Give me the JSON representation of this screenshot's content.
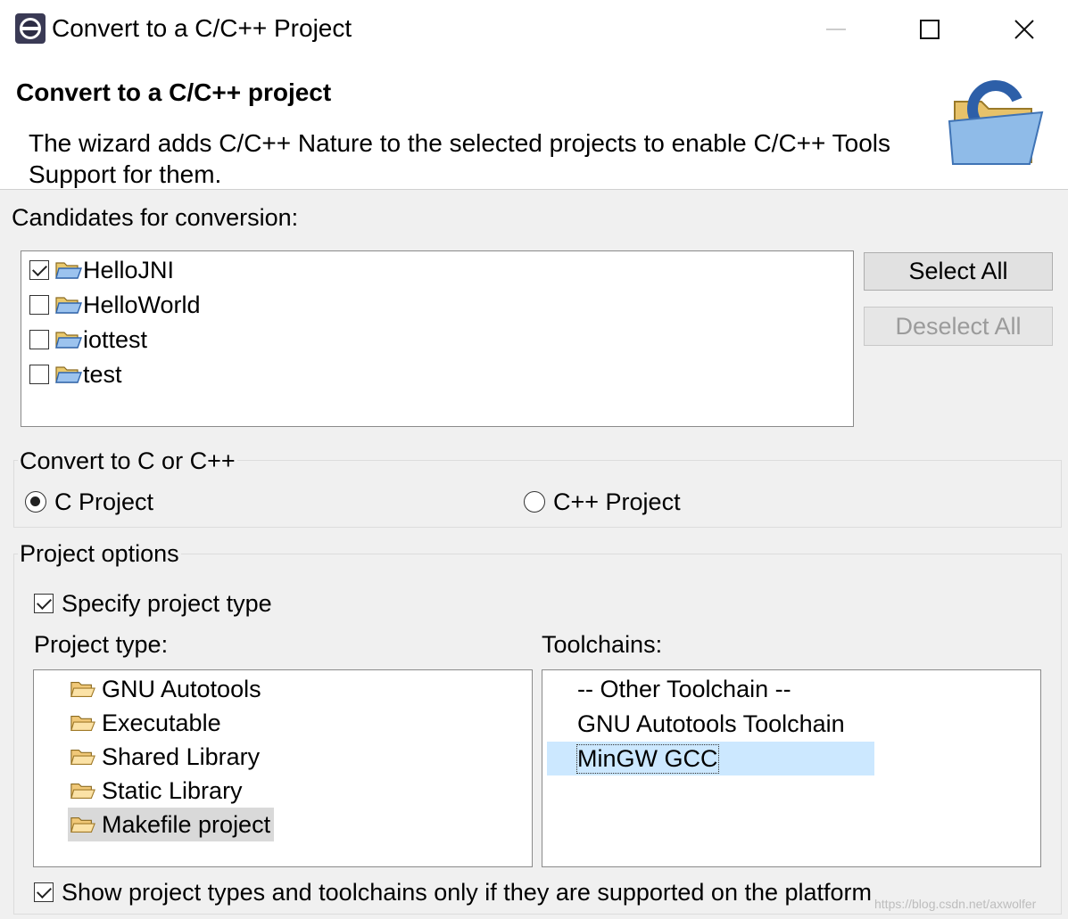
{
  "window": {
    "title": "Convert to a C/C++ Project",
    "controls": {
      "minimize": "minimize",
      "maximize": "maximize",
      "close": "close"
    }
  },
  "header": {
    "title": "Convert to a C/C++ project",
    "description": "The wizard adds C/C++ Nature to the selected projects to enable C/C++ Tools Support for them."
  },
  "candidates": {
    "label": "Candidates for conversion:",
    "items": [
      {
        "name": "HelloJNI",
        "checked": true
      },
      {
        "name": "HelloWorld",
        "checked": false
      },
      {
        "name": "iottest",
        "checked": false
      },
      {
        "name": "test",
        "checked": false
      }
    ],
    "select_all": "Select All",
    "deselect_all": "Deselect All"
  },
  "convert_to": {
    "label": "Convert to C or C++",
    "options": [
      {
        "label": "C Project",
        "selected": true
      },
      {
        "label": "C++ Project",
        "selected": false
      }
    ]
  },
  "project_options": {
    "label": "Project options",
    "specify_type": {
      "label": "Specify project type",
      "checked": true
    },
    "project_type_label": "Project type:",
    "project_types": [
      "GNU Autotools",
      "Executable",
      "Shared Library",
      "Static Library",
      "Makefile project"
    ],
    "selected_project_type": "Makefile project",
    "toolchains_label": "Toolchains:",
    "toolchains": [
      "-- Other Toolchain --",
      "GNU Autotools Toolchain",
      "MinGW GCC"
    ],
    "selected_toolchain": "MinGW GCC",
    "show_supported": {
      "label": "Show project types and toolchains only if they are supported on the platform",
      "checked": true
    }
  },
  "watermark": "https://blog.csdn.net/axwolfer",
  "colors": {
    "selection_blue": "#cce8ff",
    "selection_gray": "#d9d9d9",
    "background": "#f0f0f0"
  }
}
